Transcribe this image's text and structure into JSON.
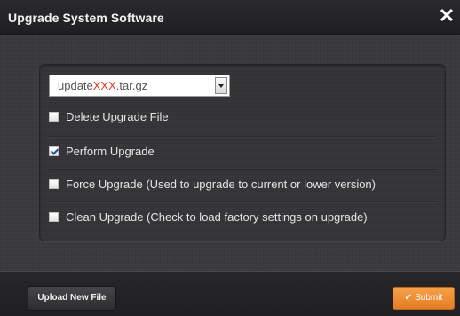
{
  "dialog": {
    "title": "Upgrade System Software",
    "close_glyph": "✕"
  },
  "file_select": {
    "prefix": "update",
    "highlight": "XXX",
    "suffix": ".tar.gz"
  },
  "options": [
    {
      "label": "Delete Upgrade File",
      "checked": false
    },
    {
      "label": "Perform Upgrade",
      "checked": true
    },
    {
      "label": "Force Upgrade (Used to upgrade to current or lower version)",
      "checked": false
    },
    {
      "label": "Clean Upgrade (Check to load factory settings on upgrade)",
      "checked": false
    }
  ],
  "footer": {
    "upload_label": "Upload New File",
    "submit_label": "Submit",
    "submit_icon": "✔"
  },
  "colors": {
    "accent_orange": "#ef8f35",
    "highlight_red": "#e23a1e"
  }
}
